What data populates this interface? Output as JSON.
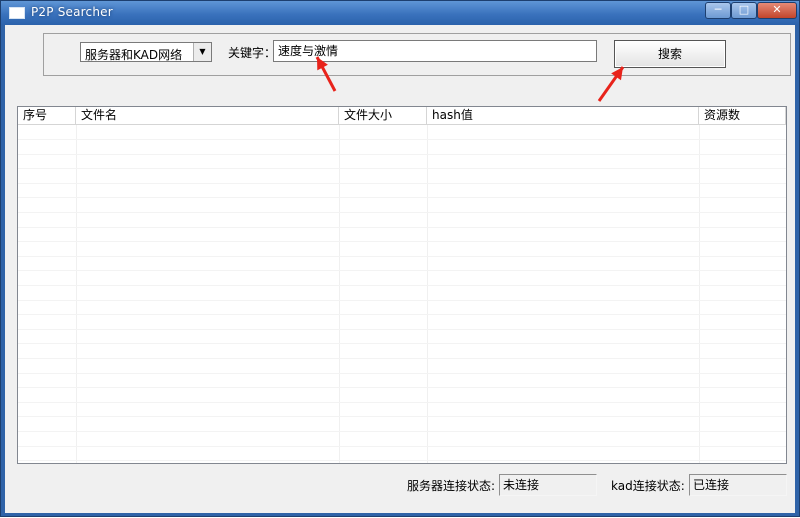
{
  "window": {
    "title": "P2P Searcher",
    "min_glyph": "─",
    "max_glyph": "□",
    "close_glyph": "✕"
  },
  "search": {
    "network_select": "服务器和KAD网络",
    "select_arrow": "▼",
    "keyword_label": "关键字：",
    "keyword_value": "速度与激情",
    "search_button": "搜索"
  },
  "table": {
    "columns": [
      "序号",
      "文件名",
      "文件大小",
      "hash值",
      "资源数"
    ],
    "rows": []
  },
  "status": {
    "server_label": "服务器连接状态:",
    "server_value": "未连接",
    "kad_label": "kad连接状态:",
    "kad_value": "已连接"
  },
  "annotations": {
    "arrow_color": "#e8231b"
  }
}
